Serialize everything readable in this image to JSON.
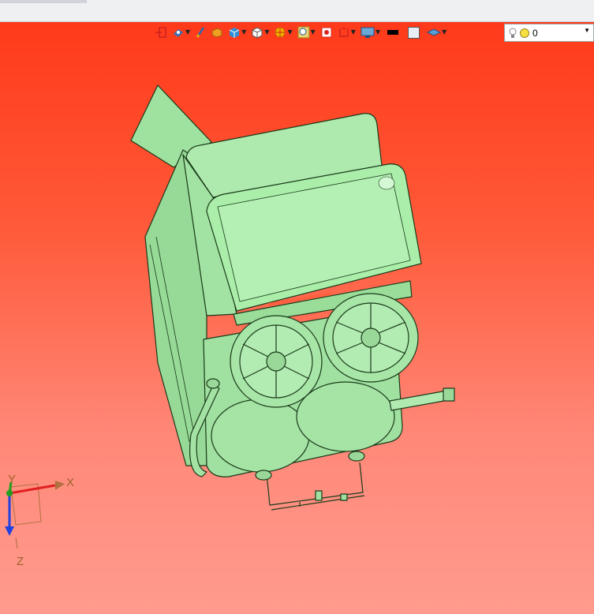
{
  "toolbar": {
    "icons": [
      "exit-sketch-icon",
      "render-mode-icon",
      "pencil-icon",
      "box-select-icon",
      "view-cube-icon",
      "iso-view-icon",
      "section-icon",
      "zoom-icon",
      "fit-icon",
      "frame-icon",
      "display-icon",
      "color-black-icon",
      "background-icon",
      "layer-icon"
    ],
    "light_value": "0"
  },
  "triad": {
    "x_label": "X",
    "y_label": "Y",
    "z_label": "Z"
  },
  "colors": {
    "background_top": "#ff3a1a",
    "background_bottom": "#ff9b8f",
    "model_fill": "#a8e8a8",
    "model_edge": "#1a3a1a"
  }
}
